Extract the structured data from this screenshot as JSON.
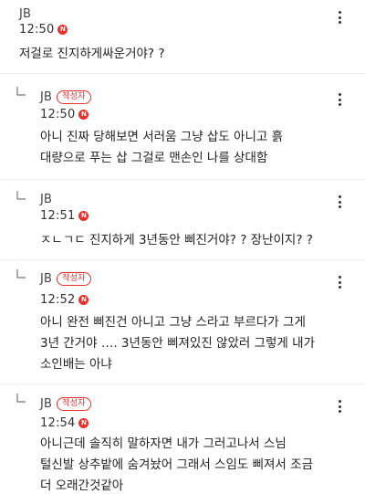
{
  "comments": [
    {
      "author": "JB",
      "time": "12:50",
      "new_badge": "N",
      "is_writer": false,
      "is_reply": false,
      "text": [
        "저걸로 진지하게싸운거야? ?"
      ]
    },
    {
      "author": "JB",
      "writer_badge": "작성자",
      "time": "12:50",
      "new_badge": "N",
      "is_writer": true,
      "is_reply": true,
      "text": [
        "아니 진짜 당해보면 서러움 그냥 삽도 아니고 흙",
        "대량으로 푸는 삽 그걸로 맨손인 나를 상대함"
      ]
    },
    {
      "author": "JB",
      "time": "12:51",
      "new_badge": "N",
      "is_writer": false,
      "is_reply": true,
      "text": [
        "ㅈㄴㄱㄷ 진지하게 3년동안 삐진거야? ? 장난이지? ?"
      ]
    },
    {
      "author": "JB",
      "writer_badge": "작성자",
      "time": "12:52",
      "new_badge": "N",
      "is_writer": true,
      "is_reply": true,
      "text": [
        "아니 완전 삐진건 아니고 그냥 스라고 부르다가 그게",
        "3년 간거야 …. 3년동안 삐져있진 않았러 그렇게 내가",
        "소인배는 아냐"
      ]
    },
    {
      "author": "JB",
      "writer_badge": "작성자",
      "time": "12:54",
      "new_badge": "N",
      "is_writer": true,
      "is_reply": true,
      "text": [
        "아니근데 솔직히 말하자면 내가 그러고나서 스님",
        "털신발 상추밭에 숨겨놨어 그래서 스임도 삐져서 조금",
        "더 오래간것같아"
      ]
    }
  ],
  "colors": {
    "accent": "#e5322d",
    "divider": "#ececec"
  },
  "icons": {
    "more": "more-vertical-icon",
    "reply": "reply-arrow-icon"
  }
}
